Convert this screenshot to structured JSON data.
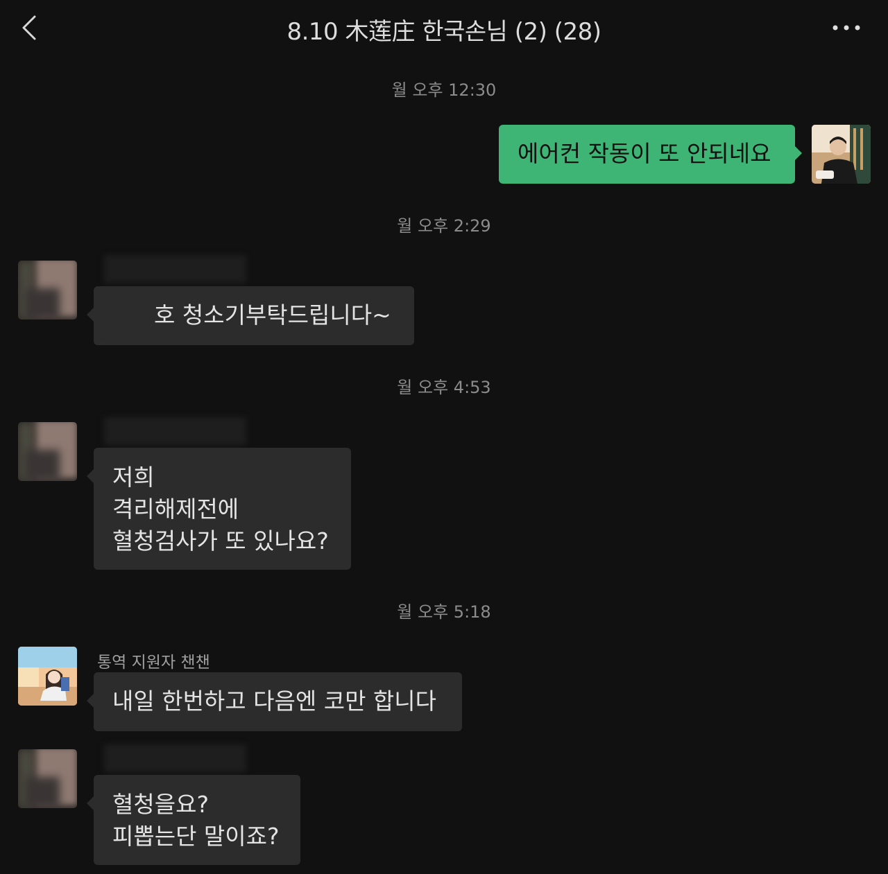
{
  "header": {
    "title": "8.10 木莲庄 한국손님 (2) (28)"
  },
  "messages": [
    {
      "timestamp": "월 오후 12:30"
    },
    {
      "side": "out",
      "text": "에어컨 작동이 또 안되네요"
    },
    {
      "timestamp": "월 오후 2:29"
    },
    {
      "side": "in",
      "text": "호 청소기부탁드립니다~"
    },
    {
      "timestamp": "월 오후 4:53"
    },
    {
      "side": "in",
      "lines": [
        "저희",
        "격리해제전에",
        "혈청검사가 또 있나요?"
      ]
    },
    {
      "timestamp": "월 오후 5:18"
    },
    {
      "side": "in",
      "sender": "통역 지원자 챈챈",
      "text": "내일 한번하고 다음엔 코만 합니다"
    },
    {
      "side": "in",
      "lines": [
        "혈청을요?",
        "피뽑는단 말이죠?"
      ]
    }
  ],
  "icons": {
    "back": "chevron-left-icon",
    "more": "more-dots-icon"
  }
}
